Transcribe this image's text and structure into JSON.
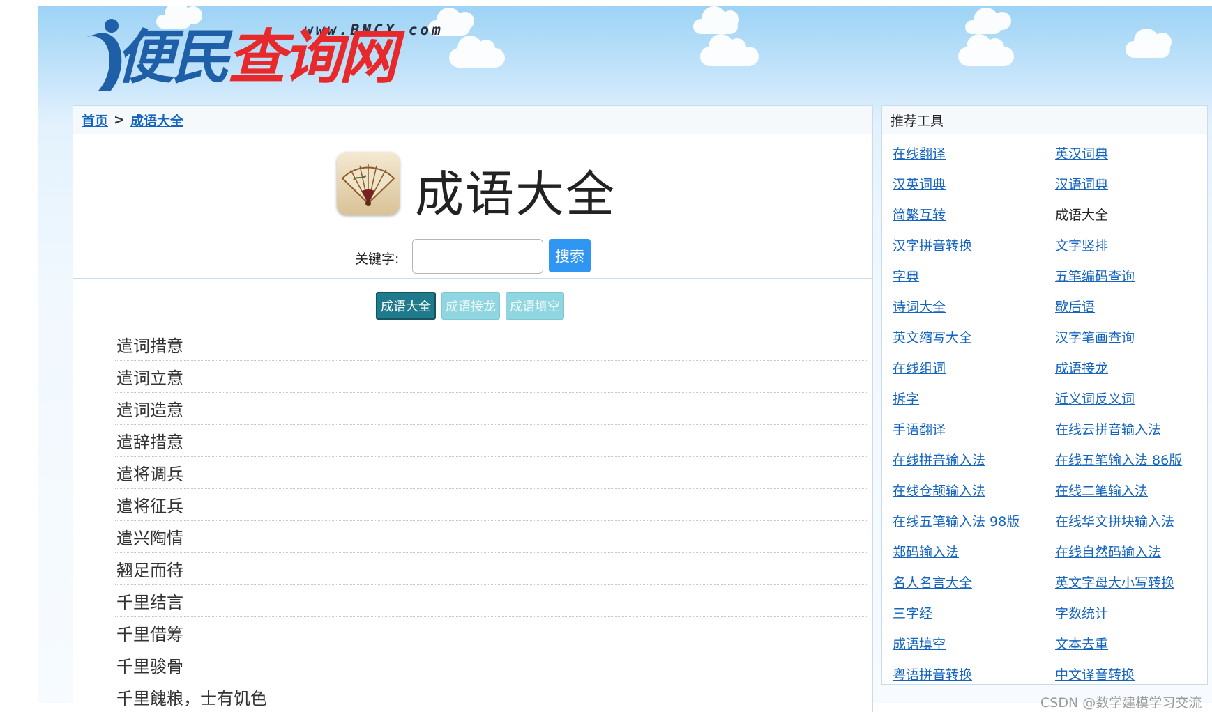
{
  "logo": {
    "url_text": "www.BMCX.com",
    "name_part1": "便民",
    "name_part2": "查询网"
  },
  "breadcrumb": {
    "home": "首页",
    "separator": ">",
    "current": "成语大全"
  },
  "header": {
    "title": "成语大全",
    "keyword_label": "关键字:",
    "keyword_value": "",
    "search_button": "搜索"
  },
  "tabs": [
    {
      "label": "成语大全",
      "active": true
    },
    {
      "label": "成语接龙",
      "active": false
    },
    {
      "label": "成语填空",
      "active": false
    }
  ],
  "idioms": [
    "遣词措意",
    "遣词立意",
    "遣词造意",
    "遣辞措意",
    "遣将调兵",
    "遣将征兵",
    "遣兴陶情",
    "翘足而待",
    "千里结言",
    "千里借筹",
    "千里骏骨",
    "千里餽粮，士有饥色"
  ],
  "sidebar": {
    "title": "推荐工具",
    "tools": [
      {
        "label": "在线翻译",
        "current": false
      },
      {
        "label": "英汉词典",
        "current": false
      },
      {
        "label": "汉英词典",
        "current": false
      },
      {
        "label": "汉语词典",
        "current": false
      },
      {
        "label": "简繁互转",
        "current": false
      },
      {
        "label": "成语大全",
        "current": true
      },
      {
        "label": "汉字拼音转换",
        "current": false
      },
      {
        "label": "文字竖排",
        "current": false
      },
      {
        "label": "字典",
        "current": false
      },
      {
        "label": "五笔编码查询",
        "current": false
      },
      {
        "label": "诗词大全",
        "current": false
      },
      {
        "label": "歇后语",
        "current": false
      },
      {
        "label": "英文缩写大全",
        "current": false
      },
      {
        "label": "汉字笔画查询",
        "current": false
      },
      {
        "label": "在线组词",
        "current": false
      },
      {
        "label": "成语接龙",
        "current": false
      },
      {
        "label": "拆字",
        "current": false
      },
      {
        "label": "近义词反义词",
        "current": false
      },
      {
        "label": "手语翻译",
        "current": false
      },
      {
        "label": "在线云拼音输入法",
        "current": false
      },
      {
        "label": "在线拼音输入法",
        "current": false
      },
      {
        "label": "在线五笔输入法 86版",
        "current": false
      },
      {
        "label": "在线仓颉输入法",
        "current": false
      },
      {
        "label": "在线二笔输入法",
        "current": false
      },
      {
        "label": "在线五笔输入法 98版",
        "current": false
      },
      {
        "label": "在线华文拼块输入法",
        "current": false
      },
      {
        "label": "郑码输入法",
        "current": false
      },
      {
        "label": "在线自然码输入法",
        "current": false
      },
      {
        "label": "名人名言大全",
        "current": false
      },
      {
        "label": "英文字母大小写转换",
        "current": false
      },
      {
        "label": "三字经",
        "current": false
      },
      {
        "label": "字数统计",
        "current": false
      },
      {
        "label": "成语填空",
        "current": false
      },
      {
        "label": "文本去重",
        "current": false
      },
      {
        "label": "粤语拼音转换",
        "current": false
      },
      {
        "label": "中文译音转换",
        "current": false
      }
    ]
  },
  "watermark": "CSDN @数学建模学习交流",
  "colors": {
    "link": "#1565c0",
    "tab_active": "#1f7a8c",
    "tab_inactive": "#8fd6e0",
    "search_button": "#2f96f2",
    "logo_blue": "#1f5fa8",
    "logo_red": "#e8292b"
  }
}
